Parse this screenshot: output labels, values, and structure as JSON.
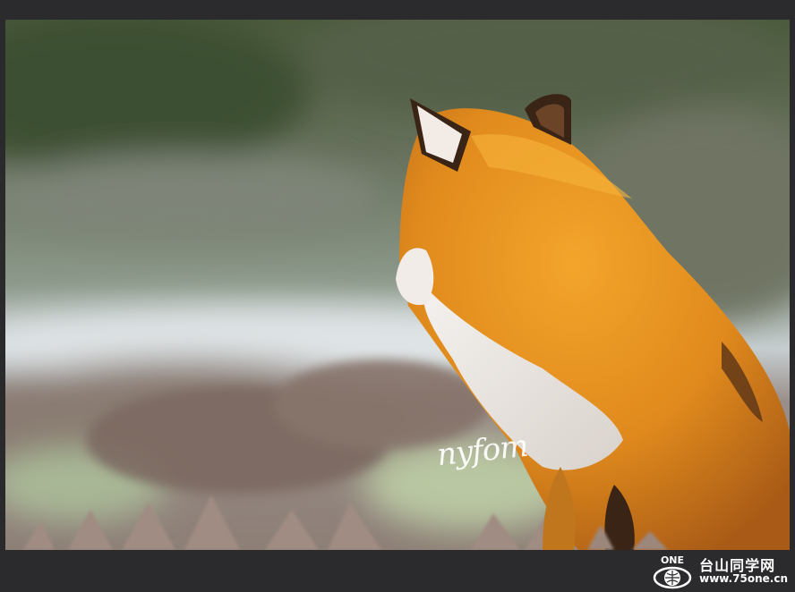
{
  "image": {
    "subject": "fox",
    "watermark_signature": "nyfom"
  },
  "logo": {
    "mark": "ONE",
    "title": "台山同学网",
    "url": "www.75one.cn"
  },
  "colors": {
    "frame": "#2b2b2e",
    "fur_orange": "#e38a1f",
    "fur_white": "#eee9e6"
  }
}
